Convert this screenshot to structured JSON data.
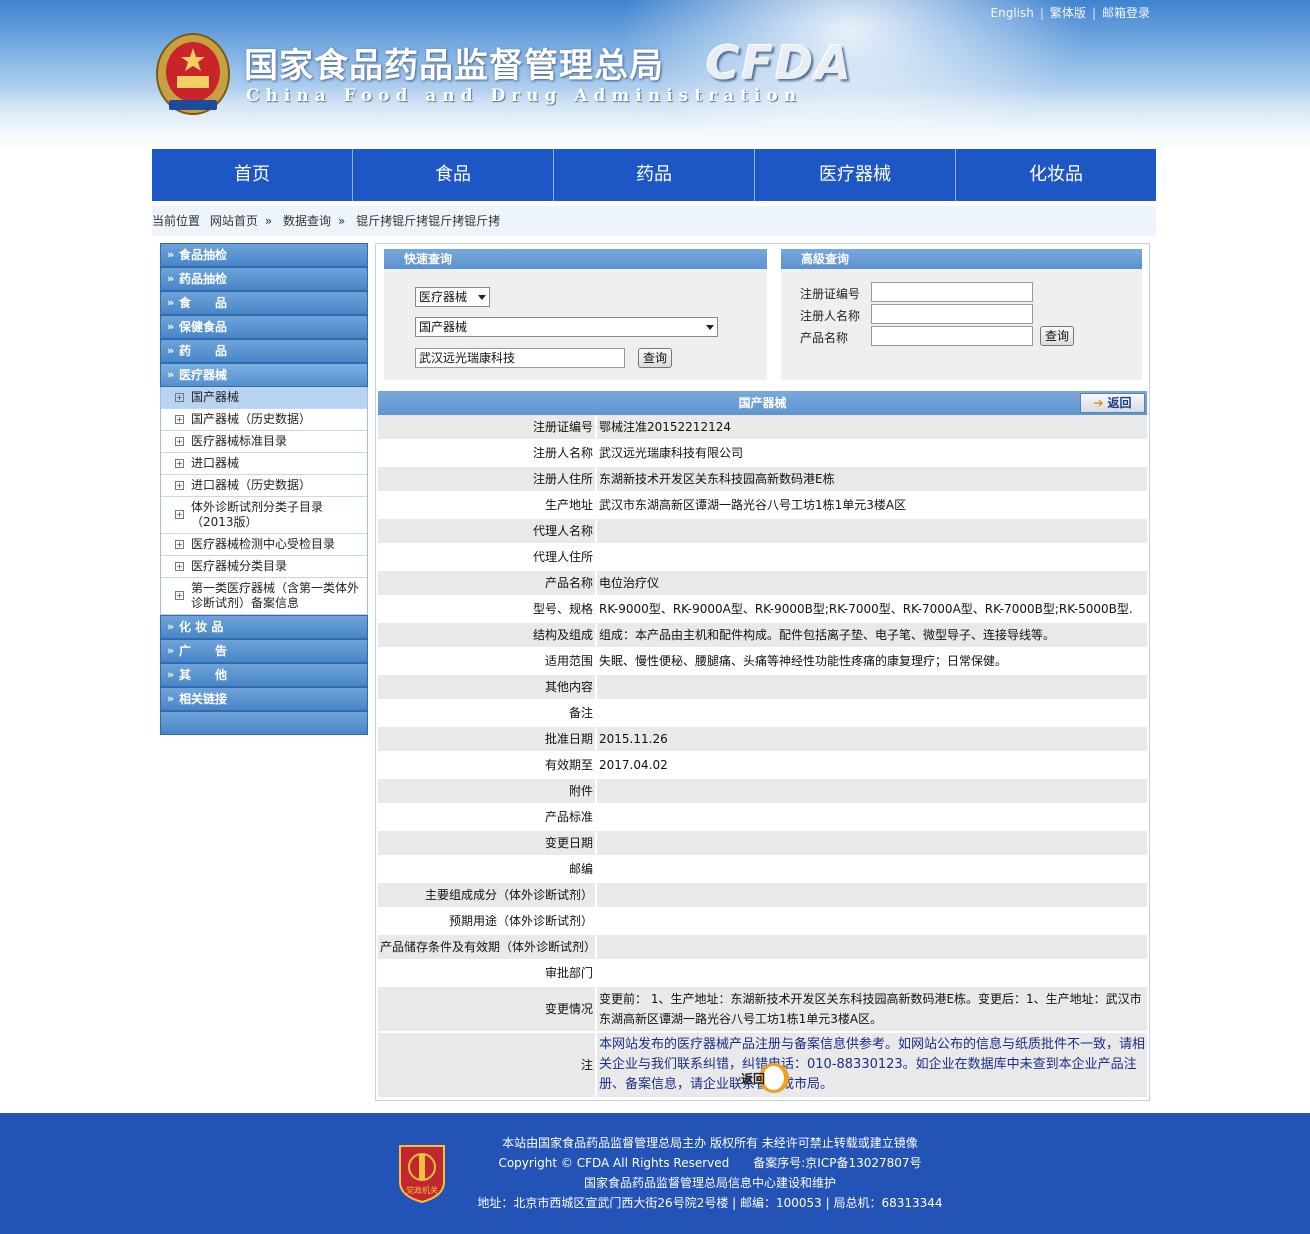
{
  "header": {
    "links": [
      "English",
      "繁体版",
      "邮箱登录"
    ],
    "title_cn": "国家食品药品监督管理总局",
    "title_en": "China Food and Drug Administration",
    "abbr": "CFDA",
    "colors": {
      "nav": "#1d56c5",
      "footer": "#2353b7",
      "panel_header": "#5b92cf"
    }
  },
  "nav": [
    "首页",
    "食品",
    "药品",
    "医疗器械",
    "化妆品"
  ],
  "breadcrumb": {
    "label": "当前位置",
    "items": [
      "网站首页",
      "数据查询",
      "锟斤拷锟斤拷锟斤拷锟斤拷"
    ]
  },
  "sidebar": {
    "top": [
      {
        "label": "食品抽检",
        "icon": "double-chevron-icon"
      },
      {
        "label": "药品抽检",
        "icon": "double-chevron-icon"
      },
      {
        "label": "食　　品",
        "icon": "double-chevron-icon"
      },
      {
        "label": "保健食品",
        "icon": "double-chevron-icon"
      },
      {
        "label": "药　　品",
        "icon": "double-chevron-icon"
      },
      {
        "label": "医疗器械",
        "icon": "double-chevron-icon"
      }
    ],
    "sub": [
      "国产器械",
      "国产器械（历史数据）",
      "医疗器械标准目录",
      "进口器械",
      "进口器械（历史数据）",
      "体外诊断试剂分类子目录（2013版）",
      "医疗器械检测中心受检目录",
      "医疗器械分类目录",
      "第一类医疗器械（含第一类体外诊断试剂）备案信息"
    ],
    "bottom": [
      {
        "label": "化 妆 品",
        "icon": "double-chevron-icon"
      },
      {
        "label": "广　　告",
        "icon": "double-chevron-icon"
      },
      {
        "label": "其　　他",
        "icon": "double-chevron-icon"
      },
      {
        "label": "相关链接",
        "icon": "double-chevron-icon"
      }
    ]
  },
  "quick": {
    "title": "快速查询",
    "category": "医疗器械",
    "database": "国产器械",
    "keyword": "武汉远光瑞康科技",
    "search": "查询"
  },
  "advanced": {
    "title": "高级查询",
    "fields": [
      "注册证编号",
      "注册人名称",
      "产品名称"
    ],
    "search": "查询"
  },
  "detail": {
    "title": "国产器械",
    "back": "返回",
    "rows": [
      {
        "k": "注册证编号",
        "v": "鄂械注准20152212124"
      },
      {
        "k": "注册人名称",
        "v": "武汉远光瑞康科技有限公司"
      },
      {
        "k": "注册人住所",
        "v": "东湖新技术开发区关东科技园高新数码港E栋"
      },
      {
        "k": "生产地址",
        "v": "武汉市东湖高新区谭湖一路光谷八号工坊1栋1单元3楼A区"
      },
      {
        "k": "代理人名称",
        "v": ""
      },
      {
        "k": "代理人住所",
        "v": ""
      },
      {
        "k": "产品名称",
        "v": "电位治疗仪"
      },
      {
        "k": "型号、规格",
        "v": "RK-9000型、RK-9000A型、RK-9000B型;RK-7000型、RK-7000A型、RK-7000B型;RK-5000B型."
      },
      {
        "k": "结构及组成",
        "v": "组成：本产品由主机和配件构成。配件包括离子垫、电子笔、微型导子、连接导线等。"
      },
      {
        "k": "适用范围",
        "v": "失眠、慢性便秘、腰腿痛、头痛等神经性功能性疼痛的康复理疗；日常保健。"
      },
      {
        "k": "其他内容",
        "v": ""
      },
      {
        "k": "备注",
        "v": ""
      },
      {
        "k": "批准日期",
        "v": "2015.11.26"
      },
      {
        "k": "有效期至",
        "v": "2017.04.02"
      },
      {
        "k": "附件",
        "v": ""
      },
      {
        "k": "产品标准",
        "v": ""
      },
      {
        "k": "变更日期",
        "v": ""
      },
      {
        "k": "邮编",
        "v": ""
      },
      {
        "k": "主要组成成分（体外诊断试剂）",
        "v": ""
      },
      {
        "k": "预期用途（体外诊断试剂）",
        "v": ""
      },
      {
        "k": "产品储存条件及有效期（体外诊断试剂）",
        "v": ""
      },
      {
        "k": "审批部门",
        "v": ""
      },
      {
        "k": "变更情况",
        "v": "变更前： 1、生产地址：东湖新技术开发区关东科技园高新数码港E栋。变更后：1、生产地址：武汉市东湖高新区谭湖一路光谷八号工坊1栋1单元3楼A区。"
      },
      {
        "k": "注",
        "v": "本网站发布的医疗器械产品注册与备案信息供参考。如网站公布的信息与纸质批件不一致，请相关企业与我们联系纠错，纠错电话：010-88330123。如企业在数据库中未查到本企业产品注册、备案信息，请企业联系省局或市局。"
      }
    ],
    "back_bottom": "返回"
  },
  "footer": {
    "badge": "党政机关",
    "lines": [
      "本站由国家食品药品监督管理总局主办 版权所有 未经许可禁止转载或建立镜像",
      "Copyright © CFDA All Rights Reserved　　备案序号:京ICP备13027807号",
      "国家食品药品监督管理总局信息中心建设和维护",
      "地址：北京市西城区宣武门西大街26号院2号楼 | 邮编：100053 | 局总机：68313344"
    ]
  }
}
